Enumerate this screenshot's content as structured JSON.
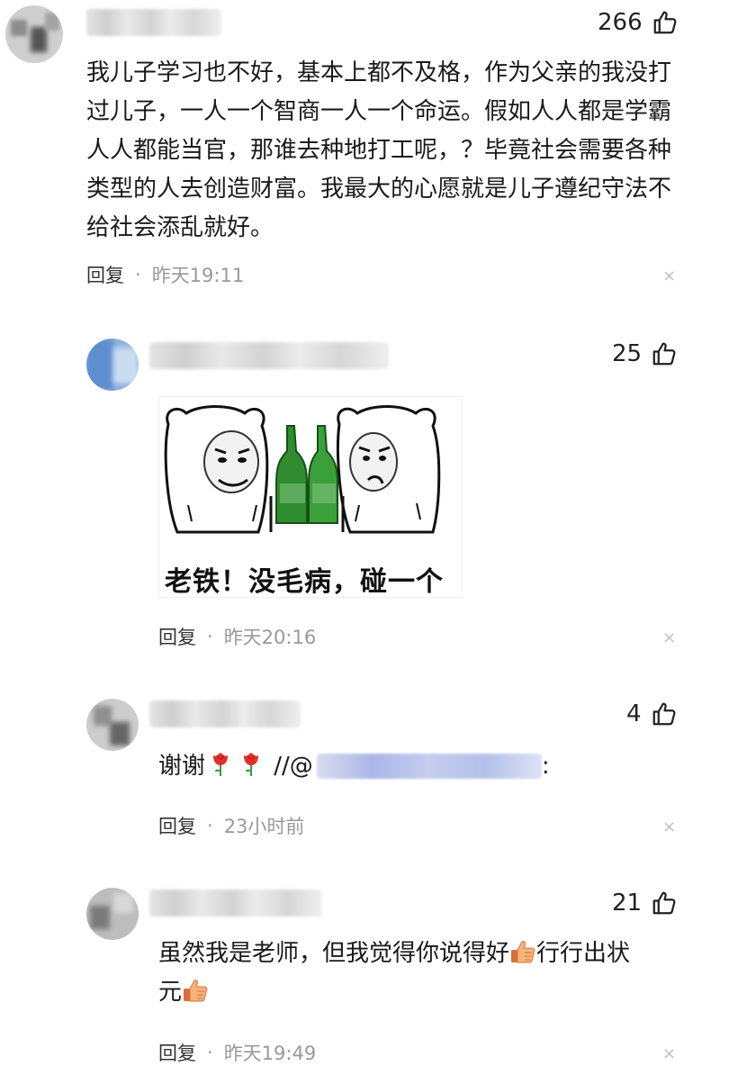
{
  "comments": [
    {
      "likes": "266",
      "text": "我儿子学习也不好，基本上都不及格，作为父亲的我没打过儿子，一人一个智商一人一个命运。假如人人都是学霸人人都能当官，那谁去种地打工呢，？毕竟社会需要各种类型的人去创造财富。我最大的心愿就是儿子遵纪守法不给社会添乱就好。",
      "reply": "回复",
      "dot": "·",
      "time": "昨天19:11",
      "close": "×"
    },
    {
      "likes": "25",
      "sticker_caption": "老铁！没毛病，碰一个",
      "reply": "回复",
      "dot": "·",
      "time": "昨天20:16",
      "close": "×"
    },
    {
      "likes": "4",
      "text_prefix": "谢谢",
      "text_sep": " //@",
      "text_suffix": ":",
      "reply": "回复",
      "dot": "·",
      "time": "23小时前",
      "close": "×"
    },
    {
      "likes": "21",
      "text_a": "虽然我是老师，但我觉得你说得好",
      "text_b": "行行出状",
      "text_c": "元",
      "reply": "回复",
      "dot": "·",
      "time": "昨天19:49",
      "close": "×"
    }
  ],
  "icons": {
    "like": "thumbs-up-icon",
    "flower": "rose-emoji-icon",
    "thumb_emoji": "thumbs-up-emoji-icon",
    "close": "close-icon"
  },
  "colors": {
    "text": "#1a1a1a",
    "meta": "#999999",
    "close": "#c0c0c0"
  }
}
